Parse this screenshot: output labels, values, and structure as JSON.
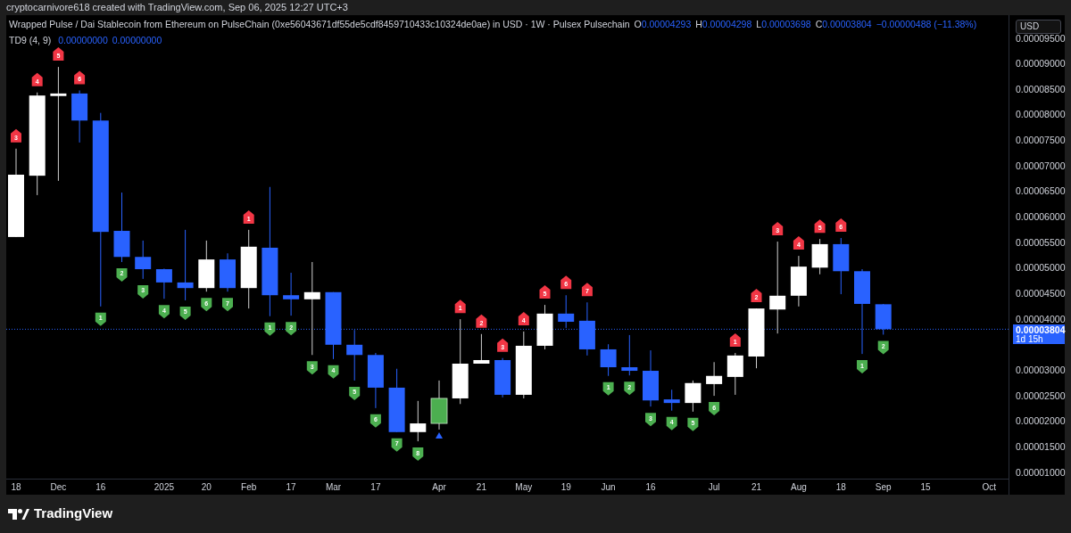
{
  "snapshot_caption": "cryptocarnivore618 created with TradingView.com, Sep 06, 2025 12:27 UTC+3",
  "legend": {
    "title": "Wrapped Pulse / Dai Stablecoin from Ethereum on PulseChain (0xe56043671df55de5cdf8459710433c10324de0ae) in USD · 1W · Pulsex Pulsechain",
    "ohlc": [
      {
        "label": "O",
        "value": "0.00004293"
      },
      {
        "label": "H",
        "value": "0.00004298"
      },
      {
        "label": "L",
        "value": "0.00003698"
      },
      {
        "label": "C",
        "value": "0.00003804"
      }
    ],
    "change": "−0.00000488 (−11.38%)"
  },
  "indicator": {
    "name": "TD9 (4, 9)",
    "values": [
      "0.00000000",
      "0.00000000"
    ]
  },
  "currency_button": "USD",
  "price_axis": [
    "0.00009500",
    "0.00009000",
    "0.00008500",
    "0.00008000",
    "0.00007500",
    "0.00007000",
    "0.00006500",
    "0.00006000",
    "0.00005500",
    "0.00005000",
    "0.00004500",
    "0.00004000",
    "0.00003000",
    "0.00002500",
    "0.00002000",
    "0.00001500",
    "0.00001000"
  ],
  "price_label": {
    "value": "0.00003804",
    "countdown": "1d 15h"
  },
  "time_axis": [
    "18",
    "Dec",
    "16",
    "2025",
    "20",
    "Feb",
    "17",
    "Mar",
    "17",
    "Apr",
    "21",
    "May",
    "19",
    "Jun",
    "16",
    "Jul",
    "21",
    "Aug",
    "18",
    "Sep",
    "15",
    "Oct"
  ],
  "td_counts": [
    {
      "kind": "sell",
      "text": "3"
    },
    {
      "kind": "sell",
      "text": "4"
    },
    {
      "kind": "sell",
      "text": "5"
    },
    {
      "kind": "sell",
      "text": "6"
    },
    {
      "kind": "buy",
      "text": "1"
    },
    {
      "kind": "buy",
      "text": "2"
    },
    {
      "kind": "buy",
      "text": "3"
    },
    {
      "kind": "buy",
      "text": "4"
    },
    {
      "kind": "buy",
      "text": "5"
    },
    {
      "kind": "buy",
      "text": "6"
    },
    {
      "kind": "buy",
      "text": "7"
    },
    {
      "kind": "sell",
      "text": "1"
    },
    {
      "kind": "buy",
      "text": "1"
    },
    {
      "kind": "buy",
      "text": "2"
    },
    {
      "kind": "buy",
      "text": "3"
    },
    {
      "kind": "buy",
      "text": "4"
    },
    {
      "kind": "buy",
      "text": "5"
    },
    {
      "kind": "buy",
      "text": "6"
    },
    {
      "kind": "buy",
      "text": "7"
    },
    {
      "kind": "buy",
      "text": "8"
    },
    {
      "kind": "sell",
      "text": "1"
    },
    {
      "kind": "sell",
      "text": "2"
    },
    {
      "kind": "sell",
      "text": "3"
    },
    {
      "kind": "sell",
      "text": "4"
    },
    {
      "kind": "sell",
      "text": "5"
    },
    {
      "kind": "sell",
      "text": "6"
    },
    {
      "kind": "sell",
      "text": "7"
    },
    {
      "kind": "buy",
      "text": "1"
    },
    {
      "kind": "buy",
      "text": "2"
    },
    {
      "kind": "buy",
      "text": "3"
    },
    {
      "kind": "buy",
      "text": "4"
    },
    {
      "kind": "buy",
      "text": "5"
    },
    {
      "kind": "buy",
      "text": "6"
    },
    {
      "kind": "sell",
      "text": "1"
    },
    {
      "kind": "sell",
      "text": "2"
    },
    {
      "kind": "sell",
      "text": "3"
    },
    {
      "kind": "sell",
      "text": "4"
    },
    {
      "kind": "sell",
      "text": "5"
    },
    {
      "kind": "sell",
      "text": "6"
    },
    {
      "kind": "buy",
      "text": "1"
    },
    {
      "kind": "buy",
      "text": "2"
    }
  ],
  "footer": {
    "brand": "TradingView"
  }
}
